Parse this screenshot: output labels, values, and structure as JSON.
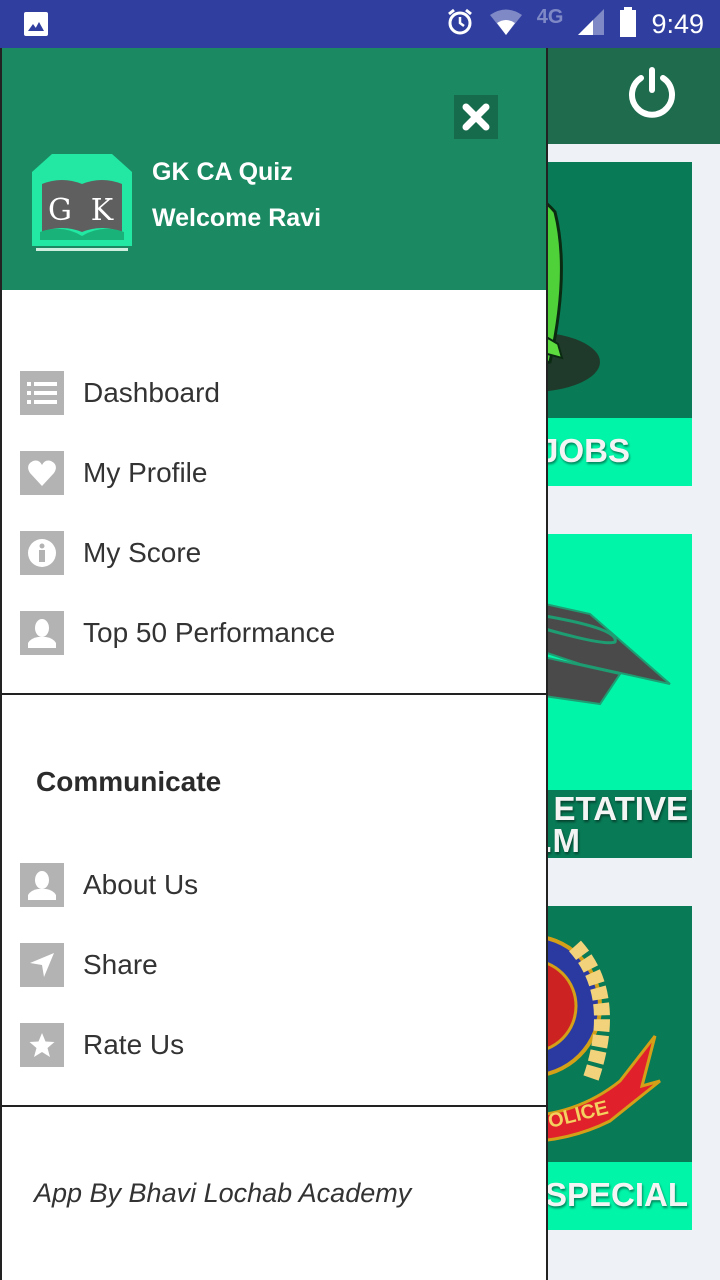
{
  "status_bar": {
    "notification_icon": "gallery-icon",
    "icons": [
      "alarm-icon",
      "wifi-icon",
      "signal-icon",
      "battery-icon"
    ],
    "network_type": "4G",
    "time": "9:49"
  },
  "background_app": {
    "toolbar": {
      "power_icon": "power-icon"
    },
    "cards": [
      {
        "label": "JOBS",
        "icon": "national-emblem-image"
      },
      {
        "label_line1": "ETATIVE",
        "label_line2": ".M",
        "icon": "graduation-cap-image"
      },
      {
        "label": "SPECIAL",
        "icon": "police-badge-image",
        "badge_text": "OLICE"
      }
    ]
  },
  "drawer": {
    "header": {
      "logo_text": "GK",
      "app_name": "GK CA Quiz",
      "welcome": "Welcome Ravi",
      "close_icon": "close-icon"
    },
    "main_menu": [
      {
        "label": "Dashboard",
        "icon": "list-icon"
      },
      {
        "label": "My Profile",
        "icon": "heart-icon"
      },
      {
        "label": "My Score",
        "icon": "info-icon"
      },
      {
        "label": "Top 50 Performance",
        "icon": "user-icon"
      }
    ],
    "section_title": "Communicate",
    "communicate_menu": [
      {
        "label": "About Us",
        "icon": "user-icon"
      },
      {
        "label": "Share",
        "icon": "send-icon"
      },
      {
        "label": "Rate Us",
        "icon": "star-icon"
      }
    ],
    "footer": "App By Bhavi Lochab Academy"
  },
  "colors": {
    "status_bar": "#303f9f",
    "drawer_header": "#1b8a63",
    "app_bar": "#1e6b4e",
    "card_dark": "#087a55",
    "card_light": "#00f5a8",
    "menu_icon_bg": "#b3b3b3"
  }
}
